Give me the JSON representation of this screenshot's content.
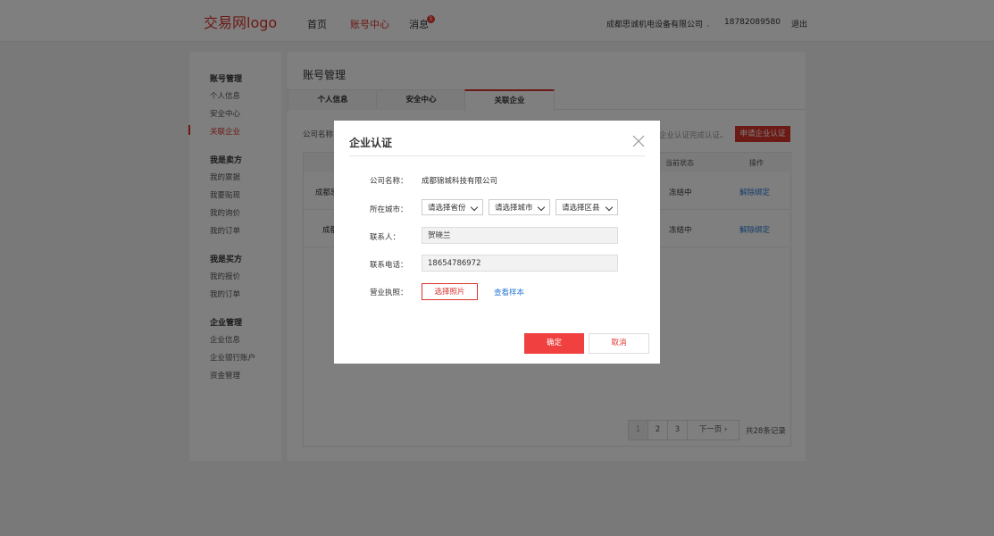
{
  "header": {
    "logo": "交易网logo",
    "nav": [
      "首页",
      "账号中心",
      "消息"
    ],
    "badge": "5",
    "company": "成都思诚机电设备有限公司",
    "phone": "18782089580",
    "logout": "退出"
  },
  "sidebar": {
    "groups": [
      {
        "title": "账号管理",
        "items": [
          "个人信息",
          "安全中心",
          "关联企业"
        ]
      },
      {
        "title": "我是卖方",
        "items": [
          "我的票据",
          "我要贴现",
          "我的询价",
          "我的订单"
        ]
      },
      {
        "title": "我是买方",
        "items": [
          "我的报价",
          "我的订单"
        ]
      },
      {
        "title": "企业管理",
        "items": [
          "企业信息",
          "企业银行账户",
          "资金管理"
        ]
      }
    ]
  },
  "main": {
    "title": "账号管理",
    "tabs": [
      "个人信息",
      "安全中心",
      "关联企业"
    ],
    "filter_label": "公司名称",
    "notice": "企业认证完成认证。",
    "apply_button": "申请企业认证",
    "table": {
      "headers": [
        "当前状态",
        "操作"
      ],
      "rows": [
        {
          "company": "成都思",
          "status": "冻结中",
          "action": "解除绑定"
        },
        {
          "company": "成都",
          "status": "冻结中",
          "action": "解除绑定"
        }
      ]
    },
    "pagination": {
      "pages": [
        "1",
        "2",
        "3"
      ],
      "next": "下一页",
      "total": "共28条记录"
    }
  },
  "modal": {
    "title": "企业认证",
    "company_label": "公司名称：",
    "company_value": "成都锦城科技有限公司",
    "city_label": "所在城市：",
    "province_placeholder": "请选择省份",
    "city_placeholder": "请选择城市",
    "district_placeholder": "请选择区县",
    "contact_label": "联系人：",
    "contact_value": "贺晓兰",
    "phone_label": "联系电话：",
    "phone_value": "18654786972",
    "license_label": "营业执照：",
    "choose_photo": "选择照片",
    "view_sample": "查看样本",
    "confirm": "确定",
    "cancel": "取消"
  },
  "colors": {
    "accent": "#d9342b",
    "link": "#2d7bd6",
    "confirm": "#f04040"
  }
}
